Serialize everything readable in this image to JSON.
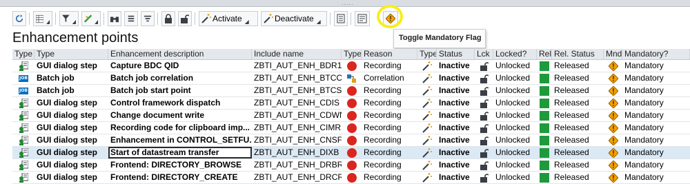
{
  "title": "Enhancement points",
  "tooltip": "Toggle Mandatory Flag",
  "toolbar": {
    "activate_label": "Activate",
    "deactivate_label": "Deactivate"
  },
  "colors": {
    "highlight": "#f7ee1a",
    "status_red": "#d9271f",
    "released_green": "#1e9a3c",
    "mandatory_diamond": "#f2a100"
  },
  "columns": [
    "Type",
    "Type",
    "Enhancement description",
    "Include name",
    "Type",
    "Reason",
    "Type",
    "Status",
    "Lck",
    "Locked?",
    "Rel",
    "Rel. Status",
    "Mnd",
    "Mandatory?"
  ],
  "rows": [
    {
      "type_icon": "gui-dialog-icon",
      "type": "GUI dialog step",
      "desc": "Capture BDC QID",
      "include": "ZBTI_AUT_ENH_BDR1",
      "reason_icon": "red-circle-icon",
      "reason": "Recording",
      "status": "Inactive",
      "locked": "Unlocked",
      "rel_status": "Released",
      "mandatory": "Mandatory"
    },
    {
      "type_icon": "job-icon",
      "type": "Batch job",
      "desc": "Batch job correlation",
      "include": "ZBTI_AUT_ENH_BTCC",
      "reason_icon": "correlation-icon",
      "reason": "Correlation",
      "status": "Inactive",
      "locked": "Unlocked",
      "rel_status": "Released",
      "mandatory": "Mandatory"
    },
    {
      "type_icon": "job-icon",
      "type": "Batch job",
      "desc": "Batch job start point",
      "include": "ZBTI_AUT_ENH_BTCS",
      "reason_icon": "red-circle-icon",
      "reason": "Recording",
      "status": "Inactive",
      "locked": "Unlocked",
      "rel_status": "Released",
      "mandatory": "Mandatory"
    },
    {
      "type_icon": "gui-dialog-icon",
      "type": "GUI dialog step",
      "desc": "Control framework dispatch",
      "include": "ZBTI_AUT_ENH_CDIS",
      "reason_icon": "red-circle-icon",
      "reason": "Recording",
      "status": "Inactive",
      "locked": "Unlocked",
      "rel_status": "Released",
      "mandatory": "Mandatory"
    },
    {
      "type_icon": "gui-dialog-icon",
      "type": "GUI dialog step",
      "desc": "Change document write",
      "include": "ZBTI_AUT_ENH_CDWN",
      "reason_icon": "red-circle-icon",
      "reason": "Recording",
      "status": "Inactive",
      "locked": "Unlocked",
      "rel_status": "Released",
      "mandatory": "Mandatory"
    },
    {
      "type_icon": "gui-dialog-icon",
      "type": "GUI dialog step",
      "desc": "Recording code for clipboard imp...",
      "include": "ZBTI_AUT_ENH_CIMR",
      "reason_icon": "red-circle-icon",
      "reason": "Recording",
      "status": "Inactive",
      "locked": "Unlocked",
      "rel_status": "Released",
      "mandatory": "Mandatory"
    },
    {
      "type_icon": "gui-dialog-icon",
      "type": "GUI dialog step",
      "desc": "Enhancement in CONTROL_SETFU...",
      "include": "ZBTI_AUT_ENH_CNSF",
      "reason_icon": "red-circle-icon",
      "reason": "Recording",
      "status": "Inactive",
      "locked": "Unlocked",
      "rel_status": "Released",
      "mandatory": "Mandatory"
    },
    {
      "type_icon": "gui-dialog-icon",
      "type": "GUI dialog step",
      "desc": "Start of datastream transfer",
      "include": "ZBTI_AUT_ENH_DIXB",
      "reason_icon": "red-circle-icon",
      "reason": "Recording",
      "status": "Inactive",
      "locked": "Unlocked",
      "rel_status": "Released",
      "mandatory": "Mandatory",
      "selected": true
    },
    {
      "type_icon": "gui-dialog-icon",
      "type": "GUI dialog step",
      "desc": "Frontend: DIRECTORY_BROWSE",
      "include": "ZBTI_AUT_ENH_DRBR",
      "reason_icon": "red-circle-icon",
      "reason": "Recording",
      "status": "Inactive",
      "locked": "Unlocked",
      "rel_status": "Released",
      "mandatory": "Mandatory"
    },
    {
      "type_icon": "gui-dialog-icon",
      "type": "GUI dialog step",
      "desc": "Frontend: DIRECTORY_CREATE",
      "include": "ZBTI_AUT_ENH_DRCR",
      "reason_icon": "red-circle-icon",
      "reason": "Recording",
      "status": "Inactive",
      "locked": "Unlocked",
      "rel_status": "Released",
      "mandatory": "Mandatory"
    }
  ]
}
